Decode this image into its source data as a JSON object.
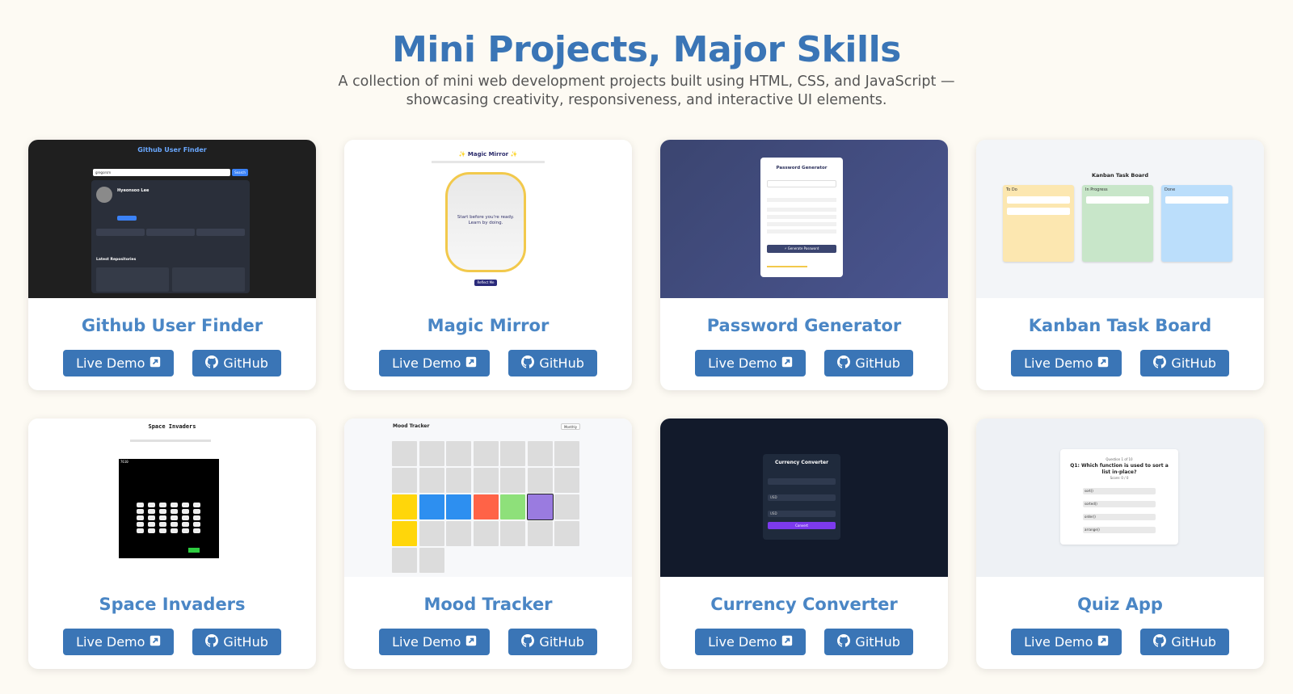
{
  "header": {
    "title": "Mini Projects, Major Skills",
    "subtitle": "A collection of mini web development projects built using HTML, CSS, and JavaScript — showcasing creativity, responsiveness, and interactive UI elements."
  },
  "buttons": {
    "demo": "Live Demo",
    "github": "GitHub"
  },
  "colors": {
    "accent": "#3a75b6",
    "background": "#fdfaf3",
    "card_title": "#4a86c5"
  },
  "projects": [
    {
      "title": "Github User Finder"
    },
    {
      "title": "Magic Mirror"
    },
    {
      "title": "Password Generator"
    },
    {
      "title": "Kanban Task Board"
    },
    {
      "title": "Space Invaders"
    },
    {
      "title": "Mood Tracker"
    },
    {
      "title": "Currency Converter"
    },
    {
      "title": "Quiz App"
    }
  ],
  "previews": {
    "github": {
      "title": "Github User Finder",
      "search_value": "gregorsm",
      "search_btn": "Search",
      "user_name": "Hyeonsoo Lee",
      "repos_heading": "Latest Repositories"
    },
    "mirror": {
      "title": "✨ Magic Mirror ✨",
      "message": "Start before you're ready. Learn by doing.",
      "button": "Reflect Me"
    },
    "password": {
      "title": "Password Generator",
      "button": "⚡ Generate Password"
    },
    "kanban": {
      "title": "Kanban Task Board",
      "col1": "To Do",
      "col2": "In Progress",
      "col3": "Done"
    },
    "invaders": {
      "title": "Space Invaders",
      "score": "7610"
    },
    "mood": {
      "title": "Mood Tracker",
      "view": "Monthly"
    },
    "currency": {
      "title": "Currency Converter",
      "from": "USD",
      "to": "USD",
      "button": "Convert"
    },
    "quiz": {
      "counter": "Question 1 of 10",
      "question": "Q1: Which function is used to sort a list in-place?",
      "score": "Score: 0 / 0",
      "options": [
        "sort()",
        "sorted()",
        "order()",
        "arrange()"
      ]
    }
  }
}
